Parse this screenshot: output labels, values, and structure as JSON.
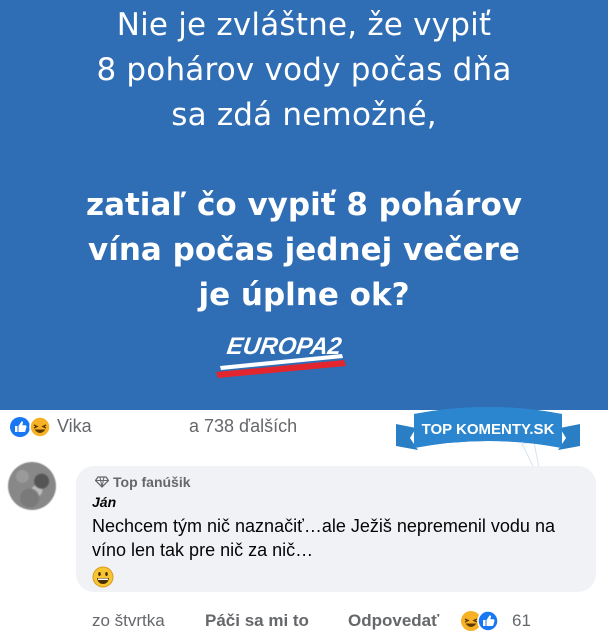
{
  "post_image": {
    "light_lines": [
      "Nie je zvláštne, že vypiť",
      "8 pohárov vody počas dňa",
      "sa zdá nemožné,"
    ],
    "bold_lines": [
      "zatiaľ čo vypiť 8 pohárov",
      "vína počas jednej večere",
      "je úplne ok?"
    ],
    "logo_text": "EUROPA2",
    "colors": {
      "background": "#2f6db4",
      "logo_red": "#e3262d"
    }
  },
  "reactions": {
    "icons": [
      "like-icon",
      "haha-icon"
    ],
    "name": "Vika",
    "others": "a 738 ďalších"
  },
  "banner": {
    "text": "TOP KOMENTY.SK"
  },
  "comment": {
    "badge": "Top fanúšik",
    "author": "Ján",
    "text": "Nechcem tým nič naznačiť…ale Ježiš nepremenil vodu na víno len tak pre nič za nič…",
    "emoji": "grinning-face-icon"
  },
  "actions": {
    "time": "zo štvrtka",
    "like": "Páči sa mi to",
    "reply": "Odpovedať",
    "reaction_count": "61"
  }
}
